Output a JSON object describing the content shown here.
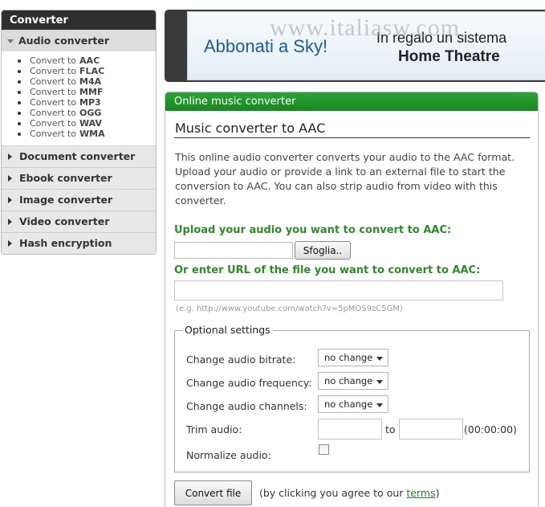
{
  "sidebar": {
    "title": "Converter",
    "open_section": "Audio converter",
    "audio_items": [
      {
        "prefix": "Convert to",
        "format": "AAC"
      },
      {
        "prefix": "Convert to",
        "format": "FLAC"
      },
      {
        "prefix": "Convert to",
        "format": "M4A"
      },
      {
        "prefix": "Convert to",
        "format": "MMF"
      },
      {
        "prefix": "Convert to",
        "format": "MP3"
      },
      {
        "prefix": "Convert to",
        "format": "OGG"
      },
      {
        "prefix": "Convert to",
        "format": "WAV"
      },
      {
        "prefix": "Convert to",
        "format": "WMA"
      }
    ],
    "sections": [
      "Document converter",
      "Ebook converter",
      "Image converter",
      "Video converter",
      "Hash encryption"
    ]
  },
  "banner": {
    "left_text": "Abbonati a Sky!",
    "right_line1": "In regalo  un sistema",
    "right_line2": "Home Theatre",
    "watermark": "www.italiasw.com"
  },
  "panel": {
    "header": "Online music converter",
    "title": "Music converter to AAC",
    "description": "This online audio converter converts your audio to the AAC format. Upload your audio or provide a link to an external file to start the conversion to AAC. You can also strip audio from video with this converter.",
    "upload_label": "Upload your audio you want to convert to AAC:",
    "browse_label": "Sfoglia..",
    "url_label": "Or enter URL of the file you want to convert to AAC:",
    "url_value": "",
    "url_example": "(e.g. http://www.youtube.com/watch?v=5pMOS9zC5GM)"
  },
  "options": {
    "legend": "Optional settings",
    "bitrate_label": "Change audio bitrate:",
    "bitrate_value": "no change",
    "frequency_label": "Change audio frequency:",
    "frequency_value": "no change",
    "channels_label": "Change audio channels:",
    "channels_value": "no change",
    "trim_label": "Trim audio:",
    "trim_to": "to",
    "trim_format": "(00:00:00)",
    "normalize_label": "Normalize audio:",
    "normalize_checked": false
  },
  "footer": {
    "convert_label": "Convert file",
    "agree_prefix": "(by clicking you agree to our ",
    "terms_label": "terms",
    "agree_suffix": ")"
  }
}
